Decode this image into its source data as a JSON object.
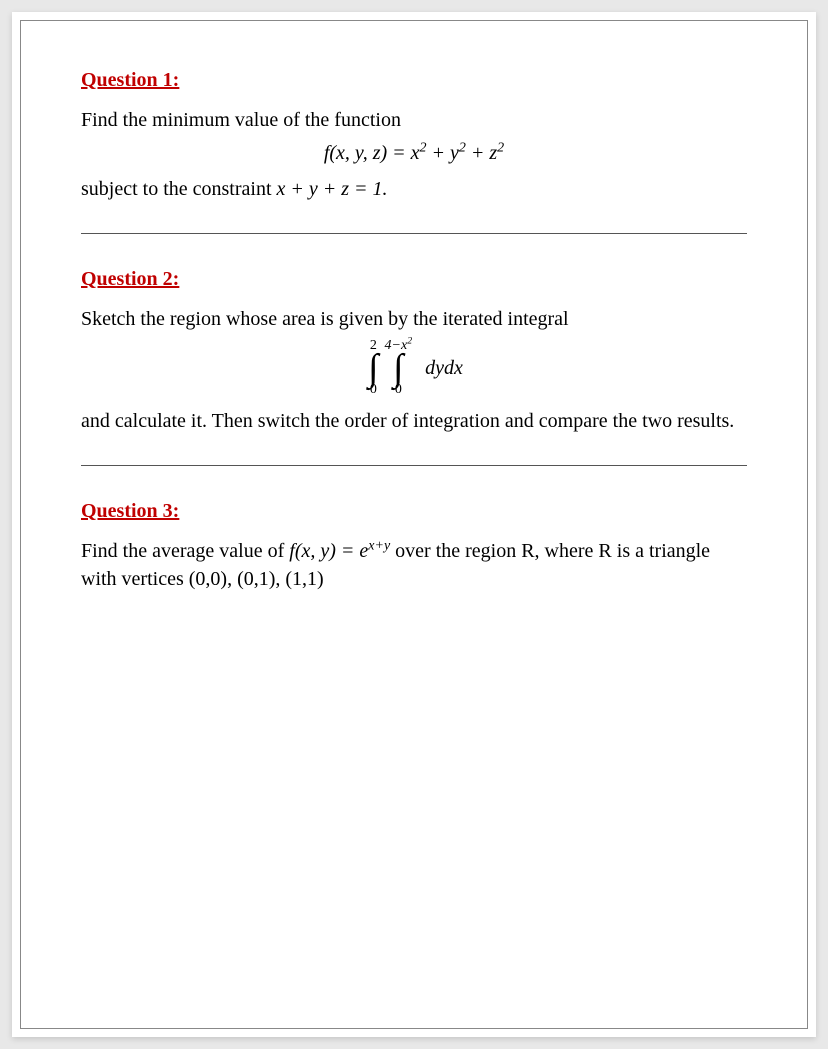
{
  "q1": {
    "title": "Question 1:",
    "line1": "Find the minimum value of the function",
    "equation_html": "f(x, y, z) = x<sup>2</sup> + y<sup>2</sup> + z<sup>2</sup>",
    "line2_prefix": "subject to the constraint ",
    "line2_math_html": "x + y + z = 1.",
    "function": "f(x,y,z) = x^2 + y^2 + z^2",
    "constraint": "x + y + z = 1"
  },
  "q2": {
    "title": "Question 2:",
    "line1": "Sketch the region whose area is given by the iterated integral",
    "integral": {
      "outer_lower": "0",
      "outer_upper": "2",
      "inner_lower": "0",
      "inner_upper_html": "4−x<sup>2</sup>",
      "inner_upper": "4 - x^2",
      "integrand": "dydx"
    },
    "line2": "and calculate it. Then switch the order of integration and compare the two results."
  },
  "q3": {
    "title": "Question 3:",
    "line1_prefix": "Find the average value of ",
    "line1_math_html": "f(x, y) = e<sup>x+y</sup>",
    "line1_suffix": " over the region R, where R is a triangle with vertices (0,0), (0,1), (1,1)",
    "function": "f(x,y) = e^(x+y)",
    "vertices": "(0,0), (0,1), (1,1)"
  }
}
